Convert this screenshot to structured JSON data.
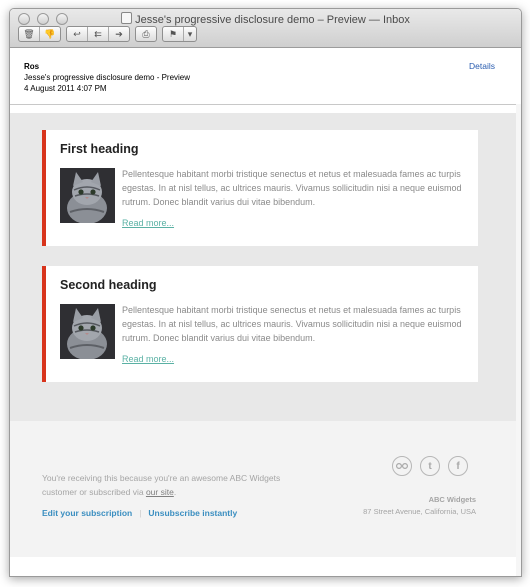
{
  "window": {
    "title": "Jesse's progressive disclosure demo – Preview — Inbox"
  },
  "toolbar": {
    "icons": [
      "trash-icon",
      "junk-icon",
      "reply-icon",
      "reply-all-icon",
      "forward-icon",
      "print-icon",
      "flag-icon",
      "chevron-down-icon"
    ]
  },
  "message": {
    "from": "Ros",
    "subject": "Jesse's progressive disclosure demo - Preview",
    "date": "4 August 2011 4:07 PM",
    "details_label": "Details"
  },
  "cards": [
    {
      "heading": "First heading",
      "body": "Pellentesque habitant morbi tristique senectus et netus et malesuada fames ac turpis egestas. In at nisl tellus, ac ultrices mauris. Vivamus sollicitudin nisi a neque euismod rutrum. Donec blandit varius dui vitae bibendum.",
      "link": "Read more..."
    },
    {
      "heading": "Second heading",
      "body": "Pellentesque habitant morbi tristique senectus et netus et malesuada fames ac turpis egestas. In at nisl tellus, ac ultrices mauris. Vivamus sollicitudin nisi a neque euismod rutrum. Donec blandit varius dui vitae bibendum.",
      "link": "Read more..."
    }
  ],
  "footer": {
    "text_before": "You're receiving this because you're an awesome ABC Widgets customer or subscribed via ",
    "site_link": "our site",
    "text_after": ".",
    "edit_link": "Edit your subscription",
    "separator": "|",
    "unsubscribe_link": "Unsubscribe instantly",
    "company_name": "ABC Widgets",
    "company_address": "87 Street Avenue, California, USA",
    "social_icons": [
      "flickr-icon",
      "twitter-icon",
      "facebook-icon"
    ]
  },
  "colors": {
    "accent_bar": "#d8341c",
    "link_teal": "#5ab1a4",
    "footer_link": "#3a8ec0",
    "details_link": "#2a5db0"
  }
}
